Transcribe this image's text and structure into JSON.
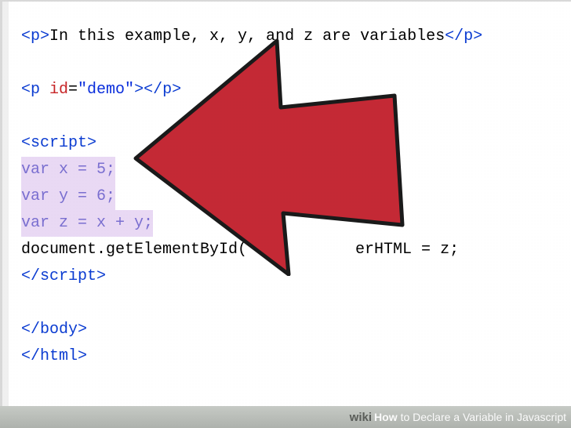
{
  "code": {
    "line1": {
      "open_p": "<p>",
      "text": "In this example, x, y, and z are variables",
      "close_p": "</p>"
    },
    "line3": {
      "open": "<p",
      "attr_name": " id",
      "eq": "=",
      "attr_val": "\"demo\"",
      "close_open": ">",
      "close_p": "</p>"
    },
    "line5": {
      "open_script": "<script>"
    },
    "line6": "var x = 5;",
    "line7": "var y = 6;",
    "line8": "var z = x + y;",
    "line9_a": "document.getElementById(",
    "line9_b": "erHTML = z;",
    "line10": {
      "close_script": "</script>"
    },
    "line12": "</body>",
    "line13": "</html>"
  },
  "arrow": {
    "name": "red-arrow-pointer",
    "fill": "#c42935",
    "stroke": "#1a1a1a"
  },
  "footer": {
    "brand": "wiki",
    "how": "How",
    "title": " to Declare a Variable in Javascript"
  }
}
